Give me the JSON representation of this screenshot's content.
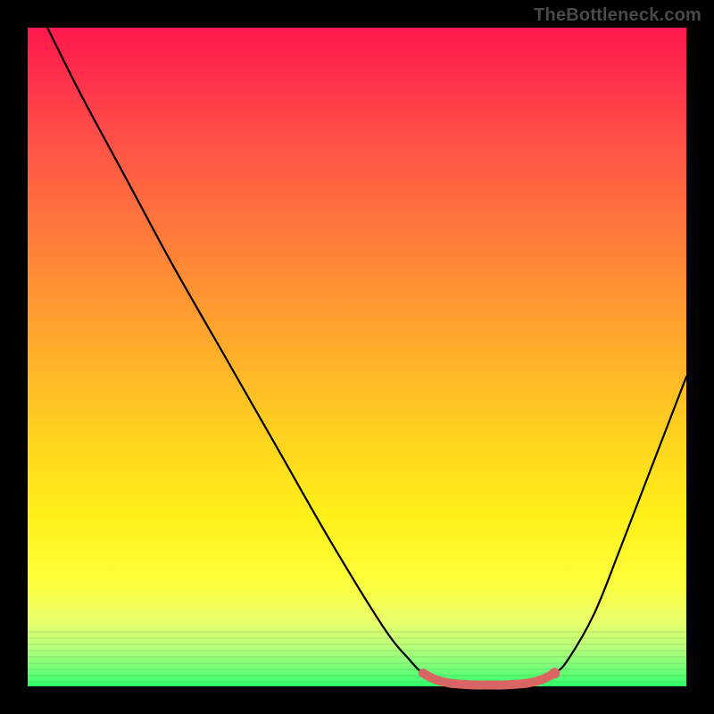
{
  "attribution": "TheBottleneck.com",
  "colors": {
    "frame": "#000000",
    "curve": "#000000",
    "marker": "#d96464"
  },
  "chart_data": {
    "type": "line",
    "title": "",
    "xlabel": "",
    "ylabel": "",
    "xlim": [
      0,
      100
    ],
    "ylim": [
      0,
      100
    ],
    "grid": false,
    "legend": false,
    "x": [
      3,
      8,
      15,
      22,
      30,
      38,
      46,
      54,
      58,
      60,
      62,
      64,
      66,
      68,
      70,
      72,
      74,
      76,
      78,
      80,
      82,
      86,
      90,
      95,
      100
    ],
    "y": [
      100,
      90,
      77,
      64,
      50,
      36,
      22,
      9,
      4,
      2,
      1,
      0.5,
      0.3,
      0.2,
      0.2,
      0.2,
      0.3,
      0.5,
      1,
      2,
      4,
      11,
      21,
      34,
      47
    ],
    "highlight_segment": {
      "x": [
        60,
        62,
        64,
        66,
        68,
        70,
        72,
        74,
        76,
        78,
        80
      ],
      "y": [
        2,
        1,
        0.5,
        0.3,
        0.2,
        0.2,
        0.2,
        0.3,
        0.5,
        1,
        2
      ]
    }
  }
}
